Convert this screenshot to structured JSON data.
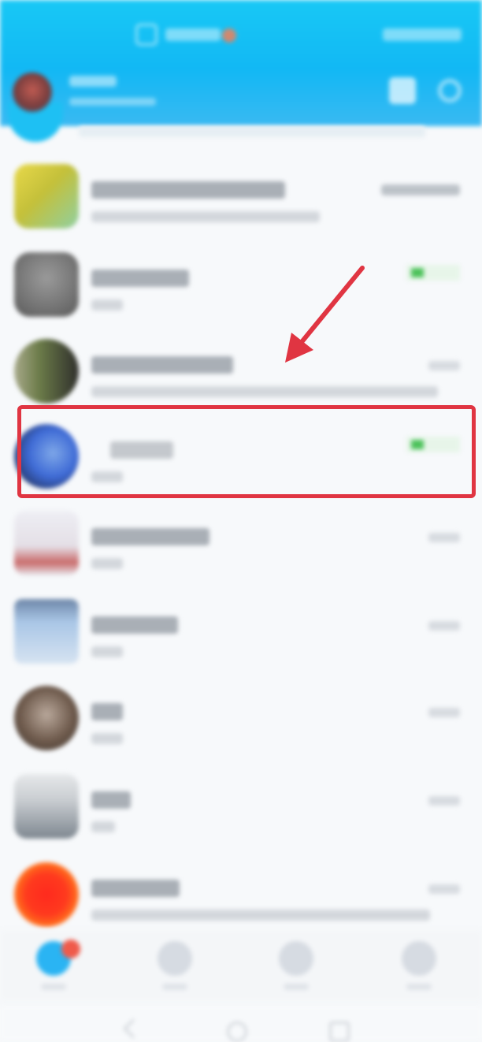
{
  "app": {
    "title": "",
    "colors": {
      "header": "#18c8f5",
      "highlight": "#e03542",
      "badge_green": "#4cc25a",
      "tab_badge": "#ef5a4a"
    }
  },
  "header": {
    "title_icon": "chat-app-icon",
    "right_icons": [
      "contacts-icon",
      "add-icon"
    ]
  },
  "conversations": [
    {
      "name": "",
      "preview": "",
      "time": "",
      "avatar_colors": [
        "#e8d94a",
        "#8fd0a2"
      ],
      "status": "read"
    },
    {
      "name": "",
      "preview": "",
      "time": "",
      "avatar_colors": [
        "#8c8c8c",
        "#6a6a6a"
      ],
      "status": "online"
    },
    {
      "name": "",
      "preview": "",
      "time": "",
      "avatar_colors": [
        "#6a7a48",
        "#3a3a38"
      ],
      "status": "read"
    },
    {
      "name": "",
      "preview": "",
      "time": "",
      "avatar_colors": [
        "#3f6bd6",
        "#151a2c"
      ],
      "status": "online",
      "highlighted": true
    },
    {
      "name": "",
      "preview": "",
      "time": "",
      "avatar_colors": [
        "#eeeef4",
        "#c96b6b"
      ],
      "status": "read"
    },
    {
      "name": "",
      "preview": "",
      "time": "",
      "avatar_colors": [
        "#a9c6e6",
        "#6d86a8"
      ],
      "status": "read"
    },
    {
      "name": "",
      "preview": "",
      "time": "",
      "avatar_colors": [
        "#6e5a4c",
        "#b9a89b"
      ],
      "status": "read"
    },
    {
      "name": "",
      "preview": "",
      "time": "",
      "avatar_colors": [
        "#c9cdd1",
        "#7e8790"
      ],
      "status": "read"
    },
    {
      "name": "",
      "preview": "",
      "time": "",
      "avatar_colors": [
        "#ff3a1e",
        "#ffb61a"
      ],
      "status": "read"
    }
  ],
  "tabs": [
    {
      "icon": "messages-icon",
      "label": "",
      "active": true,
      "badge": ""
    },
    {
      "icon": "contacts-icon",
      "label": ""
    },
    {
      "icon": "discover-icon",
      "label": ""
    },
    {
      "icon": "profile-icon",
      "label": ""
    }
  ],
  "system_nav": [
    "back-icon",
    "home-icon",
    "recents-icon"
  ],
  "annotation": {
    "arrow": "arrow-icon",
    "box_target": "conversation-row-4"
  }
}
